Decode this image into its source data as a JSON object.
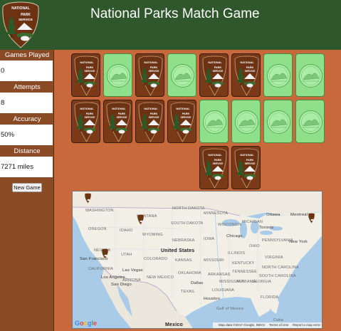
{
  "header": {
    "title": "National Parks Match Game",
    "logo_text": [
      "NATIONAL",
      "PARK",
      "SERVICE"
    ]
  },
  "sidebar": {
    "games_played_label": "Games Played",
    "games_played_value": "0",
    "attempts_label": "Attempts",
    "attempts_value": "8",
    "accuracy_label": "Accuracy",
    "accuracy_value": "50%",
    "distance_label": "Distance Traveled",
    "distance_value": "7271 miles",
    "new_game_label": "New Game"
  },
  "cards": {
    "rows": [
      [
        "back",
        "face",
        "back",
        "face",
        "back",
        "back",
        "face",
        "face"
      ],
      [
        "back",
        "back",
        "back",
        "back",
        "face",
        "face",
        "face",
        "face"
      ],
      [
        "",
        "",
        "",
        "",
        "back",
        "back",
        "",
        ""
      ]
    ],
    "back_text": [
      "NATIONAL",
      "PARK",
      "SERVICE"
    ]
  },
  "map": {
    "labels": {
      "washington": "WASHINGTON",
      "montana": "MONTANA",
      "north_dakota": "NORTH DAKOTA",
      "minnesota": "MINNESOTA",
      "oregon": "OREGON",
      "idaho": "IDAHO",
      "south_dakota": "SOUTH DAKOTA",
      "wyoming": "WYOMING",
      "wisconsin": "WISCONSIN",
      "michigan": "MICHIGAN",
      "ottawa": "Ottawa",
      "montreal": "Montreal",
      "toronto": "Toronto",
      "chicago": "Chicago",
      "nebraska": "NEBRASKA",
      "iowa": "IOWA",
      "new_york": "New York",
      "nevada": "NEVADA",
      "united_states": "United States",
      "ohio": "OHIO",
      "pennsylvania": "PENNSYLVANIA",
      "san_francisco": "San Francisco",
      "utah": "UTAH",
      "colorado": "COLORADO",
      "kansas": "KANSAS",
      "missouri": "MISSOURI",
      "illinois": "ILLINOIS",
      "kentucky": "KENTUCKY",
      "virginia": "VIRGINIA",
      "california": "CALIFORNIA",
      "las_vegas": "Las Vegas",
      "los_angeles": "Los Angeles",
      "arizona": "ARIZONA",
      "new_mexico": "NEW MEXICO",
      "oklahoma": "OKLAHOMA",
      "arkansas": "ARKANSAS",
      "tennessee": "TENNESSEE",
      "north_carolina": "NORTH CAROLINA",
      "san_diego": "San Diego",
      "south_carolina": "SOUTH CAROLINA",
      "dallas": "Dallas",
      "mississippi": "MISSISSIPPI",
      "alabama": "ALABAMA",
      "georgia": "GEORGIA",
      "texas": "TEXAS",
      "louisiana": "LOUISIANA",
      "houston": "Houston",
      "florida": "FLORIDA",
      "gulf_of_mexico": "Gulf of Mexico",
      "mexico": "Mexico",
      "cuba": "Cuba"
    },
    "google": "Google",
    "footer": {
      "data": "Map data ©2017 Google, INEGI",
      "terms": "Terms of Use",
      "report": "Report a map error"
    },
    "colors": {
      "land": "#f2efe6",
      "water": "#a9cbe8",
      "border": "#b39fcd"
    }
  },
  "colors": {
    "background": "#c7693a",
    "header": "#30572c",
    "sidebar": "#8a4a25",
    "card_back": "#7a3a18",
    "card_face": "#8fe08a"
  }
}
